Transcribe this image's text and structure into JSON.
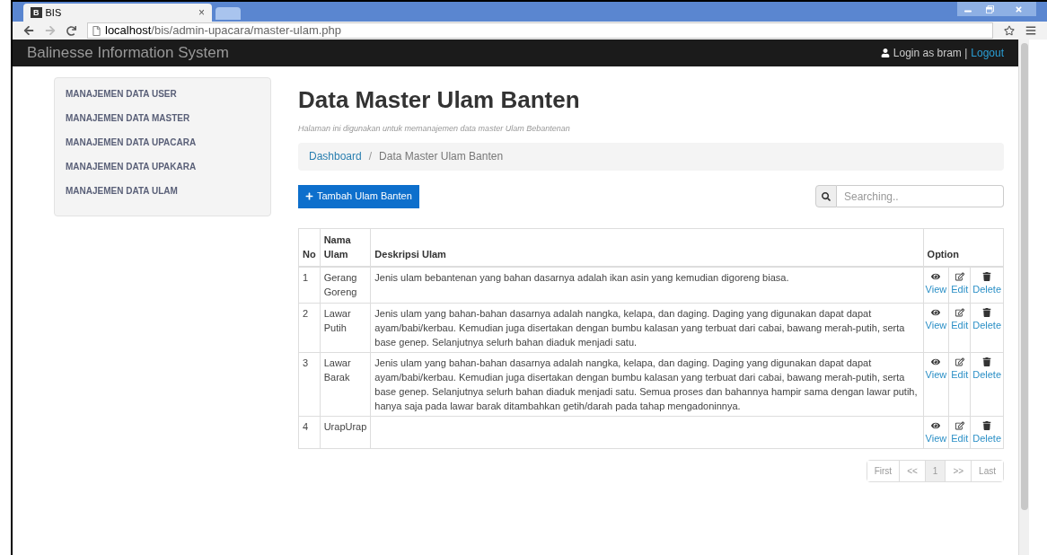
{
  "browser": {
    "tab_title": "BIS",
    "tab_icon": "B",
    "tab_close": "×",
    "url_host": "localhost",
    "url_path": "/bis/admin-upacara/master-ulam.php"
  },
  "navbar": {
    "brand": "Balinesse Information System",
    "login_text": "Login as bram |",
    "logout": "Logout"
  },
  "sidebar": {
    "items": [
      {
        "label": "MANAJEMEN DATA USER",
        "selected": false
      },
      {
        "label": "MANAJEMEN DATA MASTER",
        "selected": false
      },
      {
        "label": "MANAJEMEN DATA UPACARA",
        "selected": false
      },
      {
        "label": "MANAJEMEN DATA UPAKARA",
        "selected": false
      },
      {
        "label": "MANAJEMEN DATA ULAM",
        "selected": false
      }
    ]
  },
  "page": {
    "title": "Data Master Ulam Banten",
    "subtitle": "Halaman ini digunakan untuk memanajemen data master Ulam Bebantenan",
    "breadcrumb": [
      {
        "label": "Dashboard",
        "kind": "link"
      },
      {
        "label": "Data Master Ulam Banten",
        "kind": "current"
      }
    ],
    "breadcrumb_separator": "/",
    "add_button": "Tambah Ulam Banten",
    "search": {
      "placeholder": "Searching.."
    }
  },
  "table": {
    "columns": [
      "No",
      "Nama Ulam",
      "Deskripsi Ulam",
      "Option"
    ],
    "rows": [
      {
        "no": "1",
        "name": "Gerang Goreng",
        "description": "Jenis ulam bebantenan yang bahan dasarnya adalah ikan asin yang kemudian digoreng biasa.",
        "actions": [
          "View",
          "Edit",
          "Delete"
        ]
      },
      {
        "no": "2",
        "name": "Lawar Putih",
        "description": "Jenis ulam yang bahan-bahan dasarnya adalah nangka, kelapa, dan daging. Daging yang digunakan dapat dapat ayam/babi/kerbau. Kemudian juga disertakan dengan bumbu kalasan yang terbuat dari cabai, bawang merah-putih, serta base genep. Selanjutnya selurh bahan diaduk menjadi satu.",
        "actions": [
          "View",
          "Edit",
          "Delete"
        ]
      },
      {
        "no": "3",
        "name": "Lawar Barak",
        "description": "Jenis ulam yang bahan-bahan dasarnya adalah nangka, kelapa, dan daging. Daging yang digunakan dapat dapat ayam/babi/kerbau. Kemudian juga disertakan dengan bumbu kalasan yang terbuat dari cabai, bawang merah-putih, serta base genep. Selanjutnya selurh bahan diaduk menjadi satu. Semua proses dan bahannya hampir sama dengan lawar putih, hanya saja pada lawar barak ditambahkan getih/darah pada tahap mengadoninnya.",
        "actions": [
          "View",
          "Edit",
          "Delete"
        ]
      },
      {
        "no": "4",
        "name": "UrapUrap",
        "description": "",
        "actions": [
          "View",
          "Edit",
          "Delete"
        ]
      }
    ]
  },
  "pagination": [
    {
      "label": "First",
      "selected": false
    },
    {
      "label": "<<",
      "selected": false
    },
    {
      "label": "1",
      "selected": true
    },
    {
      "label": ">>",
      "selected": false
    },
    {
      "label": "Last",
      "selected": false
    }
  ]
}
